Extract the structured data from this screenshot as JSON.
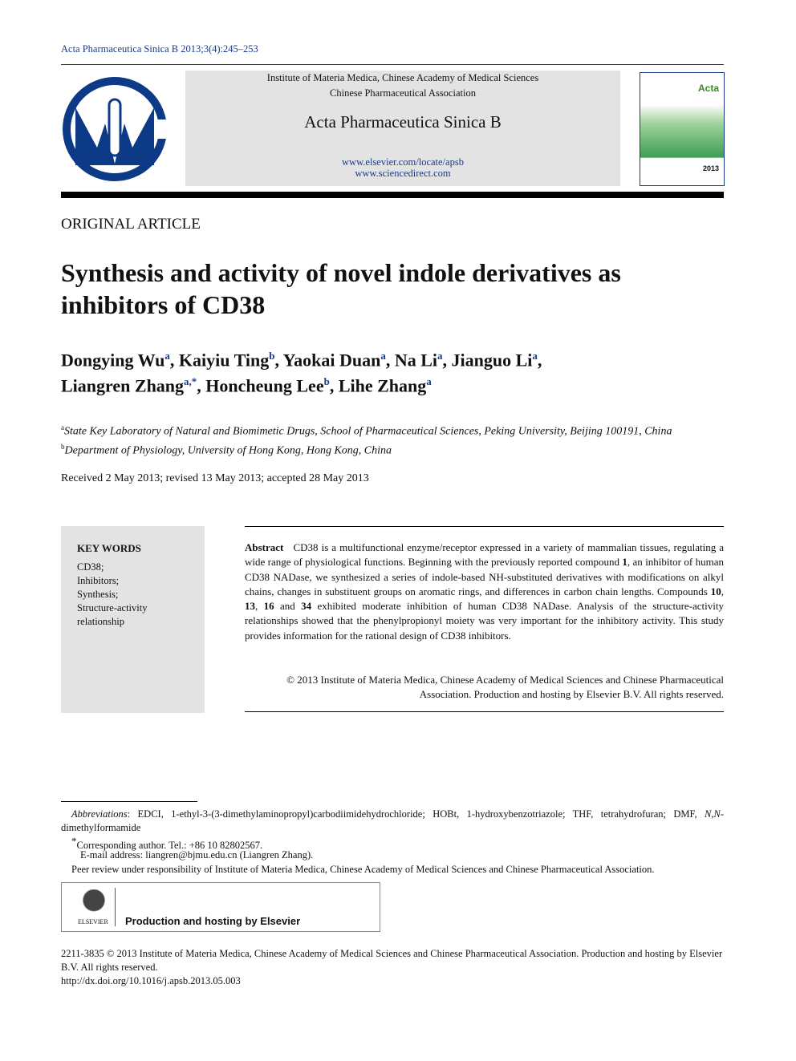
{
  "citation": "Acta Pharmaceutica Sinica B 2013;3(4):245–253",
  "header": {
    "org1": "Institute of Materia Medica, Chinese Academy of Medical Sciences",
    "org2": "Chinese Pharmaceutical Association",
    "journal": "Acta Pharmaceutica Sinica B",
    "url1": "www.elsevier.com/locate/apsb",
    "url2": "www.sciencedirect.com",
    "cover_text": "Acta Pharmaceutica Sinica B 2013",
    "brand_color": "#0d3a86"
  },
  "article_type": "ORIGINAL ARTICLE",
  "title": "Synthesis and activity of novel indole derivatives as inhibitors of CD38",
  "authors": [
    {
      "name": "Dongying Wu",
      "aff": "a"
    },
    {
      "name": "Kaiyiu Ting",
      "aff": "b"
    },
    {
      "name": "Yaokai Duan",
      "aff": "a"
    },
    {
      "name": "Na Li",
      "aff": "a"
    },
    {
      "name": "Jianguo Li",
      "aff": "a"
    },
    {
      "name": "Liangren Zhang",
      "aff": "a,*"
    },
    {
      "name": "Honcheung Lee",
      "aff": "b"
    },
    {
      "name": "Lihe Zhang",
      "aff": "a"
    }
  ],
  "affiliations": [
    {
      "key": "a",
      "text": "State Key Laboratory of Natural and Biomimetic Drugs, School of Pharmaceutical Sciences, Peking University, Beijing 100191, China"
    },
    {
      "key": "b",
      "text": "Department of Physiology, University of Hong Kong, Hong Kong, China"
    }
  ],
  "received": "Received 2 May 2013; revised 13 May 2013; accepted 28 May 2013",
  "keywords": {
    "heading": "KEY WORDS",
    "items": [
      "CD38;",
      "Inhibitors;",
      "Synthesis;",
      "Structure-activity relationship"
    ]
  },
  "abstract": {
    "label": "Abstract",
    "s1": "CD38 is a multifunctional enzyme/receptor expressed in a variety of mammalian tissues, regulating a wide range of physiological functions. Beginning with the previously reported compound ",
    "b1": "1",
    "s2": ", an inhibitor of human CD38 NADase, we synthesized a series of indole-based NH-substituted derivatives with modifications on alkyl chains, changes in substituent groups on aromatic rings, and differences in carbon chain lengths. Compounds ",
    "b2": "10",
    "s3": ", ",
    "b3": "13",
    "s4": ", ",
    "b4": "16",
    "s5": " and ",
    "b5": "34",
    "s6": " exhibited moderate inhibition of human CD38 NADase. Analysis of the structure-activity relationships showed that the phenylpropionyl moiety was very important for the inhibitory activity. This study provides information for the rational design of CD38 inhibitors.",
    "copyright": "© 2013 Institute of Materia Medica, Chinese Academy of Medical Sciences and Chinese Pharmaceutical Association. Production and hosting by Elsevier B.V. All rights reserved."
  },
  "footnotes": {
    "abbr_label": "Abbreviations",
    "abbr": ": EDCI, 1-ethyl-3-(3-dimethylaminopropyl)carbodiimidehydrochloride; HOBt, 1-hydroxybenzotriazole; THF, tetrahydrofuran; DMF, ",
    "abbr_it": "N,N",
    "abbr_end": "-dimethylformamide",
    "corr": "Corresponding author. Tel.: +86 10 82802567.",
    "email": "E-mail address: liangren@bjmu.edu.cn (Liangren Zhang).",
    "peer": "Peer review under responsibility of Institute of Materia Medica, Chinese Academy of Medical Sciences and Chinese Pharmaceutical Association."
  },
  "elsevier": {
    "logo_text": "ELSEVIER",
    "tagline": "Production and hosting by Elsevier"
  },
  "bottom": {
    "issn": "2211-3835 © 2013 Institute of Materia Medica, Chinese Academy of Medical Sciences and Chinese Pharmaceutical Association. Production and hosting by Elsevier B.V. All rights reserved.",
    "doi": "http://dx.doi.org/10.1016/j.apsb.2013.05.003"
  }
}
